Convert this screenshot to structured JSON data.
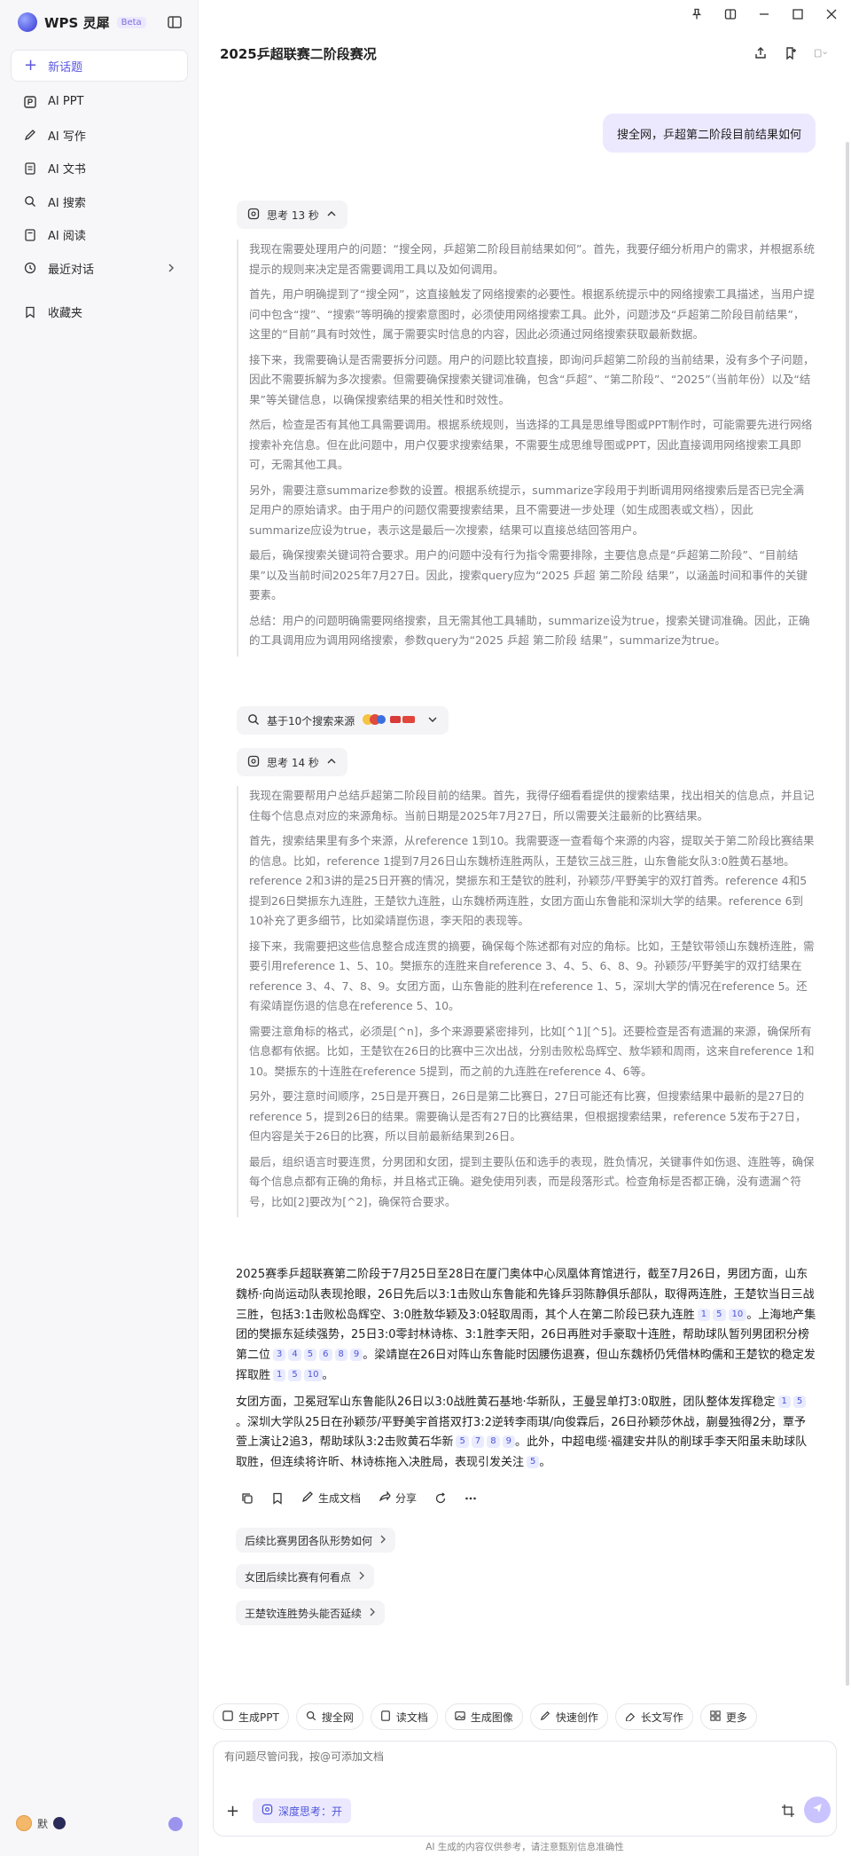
{
  "app": {
    "name": "WPS 灵犀",
    "badge": "Beta"
  },
  "sidebar": {
    "new_topic": "新话题",
    "items": [
      {
        "label": "AI PPT",
        "icon": "ppt-icon"
      },
      {
        "label": "AI 写作",
        "icon": "pen-icon"
      },
      {
        "label": "AI 文书",
        "icon": "document-icon"
      },
      {
        "label": "AI 搜索",
        "icon": "search-icon"
      },
      {
        "label": "AI 阅读",
        "icon": "read-icon"
      },
      {
        "label": "最近对话",
        "icon": "clock-icon"
      },
      {
        "label": "收藏夹",
        "icon": "bookmark-icon"
      }
    ],
    "user_name": "默"
  },
  "conversation": {
    "title": "2025乒超联赛二阶段赛况",
    "user_message": "搜全网，乒超第二阶段目前结果如何",
    "think1": {
      "label": "思考 13 秒",
      "paragraphs": [
        "我现在需要处理用户的问题：“搜全网，乒超第二阶段目前结果如何”。首先，我要仔细分析用户的需求，并根据系统提示的规则来决定是否需要调用工具以及如何调用。",
        "首先，用户明确提到了“搜全网”，这直接触发了网络搜索的必要性。根据系统提示中的网络搜索工具描述，当用户提问中包含“搜”、“搜索”等明确的搜索意图时，必须使用网络搜索工具。此外，问题涉及“乒超第二阶段目前结果”，这里的“目前”具有时效性，属于需要实时信息的内容，因此必须通过网络搜索获取最新数据。",
        "接下来，我需要确认是否需要拆分问题。用户的问题比较直接，即询问乒超第二阶段的当前结果，没有多个子问题，因此不需要拆解为多次搜索。但需要确保搜索关键词准确，包含“乒超”、“第二阶段”、“2025”（当前年份）以及“结果”等关键信息，以确保搜索结果的相关性和时效性。",
        "然后，检查是否有其他工具需要调用。根据系统规则，当选择的工具是思维导图或PPT制作时，可能需要先进行网络搜索补充信息。但在此问题中，用户仅要求搜索结果，不需要生成思维导图或PPT，因此直接调用网络搜索工具即可，无需其他工具。",
        "另外，需要注意summarize参数的设置。根据系统提示，summarize字段用于判断调用网络搜索后是否已完全满足用户的原始请求。由于用户的问题仅需要搜索结果，且不需要进一步处理（如生成图表或文档），因此summarize应设为true，表示这是最后一次搜索，结果可以直接总结回答用户。",
        "最后，确保搜索关键词符合要求。用户的问题中没有行为指令需要排除，主要信息点是“乒超第二阶段”、“目前结果”以及当前时间2025年7月27日。因此，搜索query应为“2025 乒超 第二阶段 结果”，以涵盖时间和事件的关键要素。",
        "总结：用户的问题明确需要网络搜索，且无需其他工具辅助，summarize设为true，搜索关键词准确。因此，正确的工具调用应为调用网络搜索，参数query为“2025 乒超 第二阶段 结果”，summarize为true。"
      ]
    },
    "sources": {
      "label": "基于10个搜索来源"
    },
    "think2": {
      "label": "思考 14 秒",
      "paragraphs": [
        "我现在需要帮用户总结乒超第二阶段目前的结果。首先，我得仔细看看提供的搜索结果，找出相关的信息点，并且记住每个信息点对应的来源角标。当前日期是2025年7月27日，所以需要关注最新的比赛结果。",
        "首先，搜索结果里有多个来源，从reference 1到10。我需要逐一查看每个来源的内容，提取关于第二阶段比赛结果的信息。比如，reference 1提到7月26日山东魏桥连胜两队，王楚钦三战三胜，山东鲁能女队3:0胜黄石基地。reference 2和3讲的是25日开赛的情况，樊振东和王楚钦的胜利，孙颖莎/平野美宇的双打首秀。reference 4和5提到26日樊振东九连胜，王楚钦九连胜，山东魏桥两连胜，女团方面山东鲁能和深圳大学的结果。reference 6到10补充了更多细节，比如梁靖崑伤退，李天阳的表现等。",
        "接下来，我需要把这些信息整合成连贯的摘要，确保每个陈述都有对应的角标。比如，王楚钦带领山东魏桥连胜，需要引用reference 1、5、10。樊振东的连胜来自reference 3、4、5、6、8、9。孙颖莎/平野美宇的双打结果在reference 3、4、7、8、9。女团方面，山东鲁能的胜利在reference 1、5，深圳大学的情况在reference 5。还有梁靖崑伤退的信息在reference 5、10。",
        "需要注意角标的格式，必须是[^n]，多个来源要紧密排列，比如[^1][^5]。还要检查是否有遗漏的来源，确保所有信息都有依据。比如，王楚钦在26日的比赛中三次出战，分别击败松岛辉空、敖华颖和周雨，这来自reference 1和10。樊振东的十连胜在reference 5提到，而之前的九连胜在reference 4、6等。",
        "另外，要注意时间顺序，25日是开赛日，26日是第二比赛日，27日可能还有比赛，但搜索结果中最新的是27日的reference 5，提到26日的结果。需要确认是否有27日的比赛结果，但根据搜索结果，reference 5发布于27日，但内容是关于26日的比赛，所以目前最新结果到26日。",
        "最后，组织语言时要连贯，分男团和女团，提到主要队伍和选手的表现，胜负情况，关键事件如伤退、连胜等，确保每个信息点都有正确的角标，并且格式正确。避免使用列表，而是段落形式。检查角标是否都正确，没有遗漏^符号，比如[2]要改为[^2]，确保符合要求。"
      ]
    },
    "answer": {
      "p1": [
        {
          "text": "2025赛季乒超联赛第二阶段于7月25日至28日在厦门奥体中心凤凰体育馆进行，截至7月26日，男团方面，山东魏桥·向尚运动队表现抢眼，26日先后以3:1击败山东鲁能和先锋乒羽陈静俱乐部队，取得两连胜，王楚钦当日三战三胜，包括3:1击败松岛辉空、3:0胜敖华颖及3:0轻取周雨，其个人在第二阶段已获九连胜",
          "refs": [
            "1",
            "5",
            "10"
          ]
        },
        {
          "text": "。上海地产集团的樊振东延续强势，25日3:0零封林诗栋、3:1胜李天阳，26日再胜对手豪取十连胜，帮助球队暂列男团积分榜第二位",
          "refs": [
            "3",
            "4",
            "5",
            "6",
            "8",
            "9"
          ]
        },
        {
          "text": "。梁靖崑在26日对阵山东鲁能时因腰伤退赛，但山东魏桥仍凭借林昀儒和王楚钦的稳定发挥取胜",
          "refs": [
            "1",
            "5",
            "10"
          ]
        },
        {
          "text": "。",
          "refs": []
        }
      ],
      "p2": [
        {
          "text": "女团方面，卫冕冠军山东鲁能队26日以3:0战胜黄石基地·华新队，王曼昱单打3:0取胜，团队整体发挥稳定",
          "refs": [
            "1",
            "5"
          ]
        },
        {
          "text": "。深圳大学队25日在孙颖莎/平野美宇首搭双打3:2逆转李雨琪/向俊霖后，26日孙颖莎休战，蒯曼独得2分，覃予萱上演让2追3，帮助球队3:2击败黄石华新",
          "refs": [
            "5",
            "7",
            "8",
            "9"
          ]
        },
        {
          "text": "。此外，中超电缆·福建安井队的削球手李天阳虽未助球队取胜，但连续将许昕、林诗栋拖入决胜局，表现引发关注",
          "refs": [
            "5"
          ]
        },
        {
          "text": "。",
          "refs": []
        }
      ]
    },
    "actions": {
      "generate_doc": "生成文档",
      "share": "分享"
    },
    "suggestions": [
      "后续比赛男团各队形势如何",
      "女团后续比赛有何看点",
      "王楚钦连胜势头能否延续"
    ]
  },
  "tools": [
    {
      "label": "生成PPT",
      "icon": "ppt-icon"
    },
    {
      "label": "搜全网",
      "icon": "search-icon"
    },
    {
      "label": "读文档",
      "icon": "read-icon"
    },
    {
      "label": "生成图像",
      "icon": "image-icon"
    },
    {
      "label": "快速创作",
      "icon": "pen-icon"
    },
    {
      "label": "长文写作",
      "icon": "book-icon"
    },
    {
      "label": "更多",
      "icon": "grid-icon"
    }
  ],
  "input": {
    "placeholder": "有问题尽管问我，按@可添加文档",
    "deep_think": "深度思考：开"
  },
  "disclaimer": "AI 生成的内容仅供参考，请注意甄别信息准确性"
}
